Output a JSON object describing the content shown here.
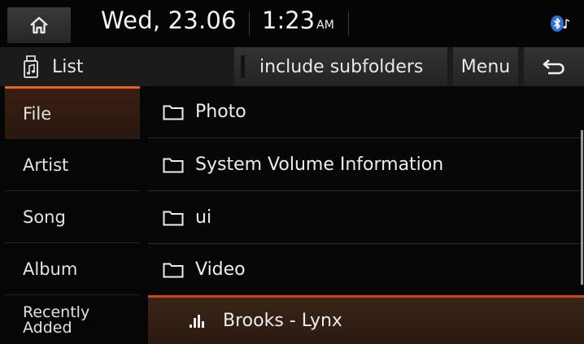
{
  "status_bar": {
    "date": "Wed, 23.06",
    "time": "1:23",
    "ampm": "AM"
  },
  "toolbar": {
    "title": "List",
    "include_subfolders_label": "include subfolders",
    "menu_label": "Menu"
  },
  "categories": [
    {
      "label": "File",
      "active": true
    },
    {
      "label": "Artist",
      "active": false
    },
    {
      "label": "Song",
      "active": false
    },
    {
      "label": "Album",
      "active": false
    },
    {
      "label": "Recently Added",
      "line1": "Recently",
      "line2": "Added",
      "active": false
    }
  ],
  "files": [
    {
      "name": "Photo",
      "type": "folder"
    },
    {
      "name": "System Volume Information",
      "type": "folder"
    },
    {
      "name": "ui",
      "type": "folder"
    },
    {
      "name": "Video",
      "type": "folder"
    },
    {
      "name": "Brooks - Lynx",
      "type": "song",
      "playing": true
    }
  ],
  "colors": {
    "accent": "#e8621c",
    "background": "#050505",
    "button": "#2b2b2b"
  },
  "icons": {
    "home": "home-icon",
    "bluetooth": "bluetooth-audio-icon",
    "usb_music": "usb-music-icon",
    "back": "back-arrow-icon",
    "folder": "folder-icon",
    "now_playing": "equalizer-icon"
  }
}
